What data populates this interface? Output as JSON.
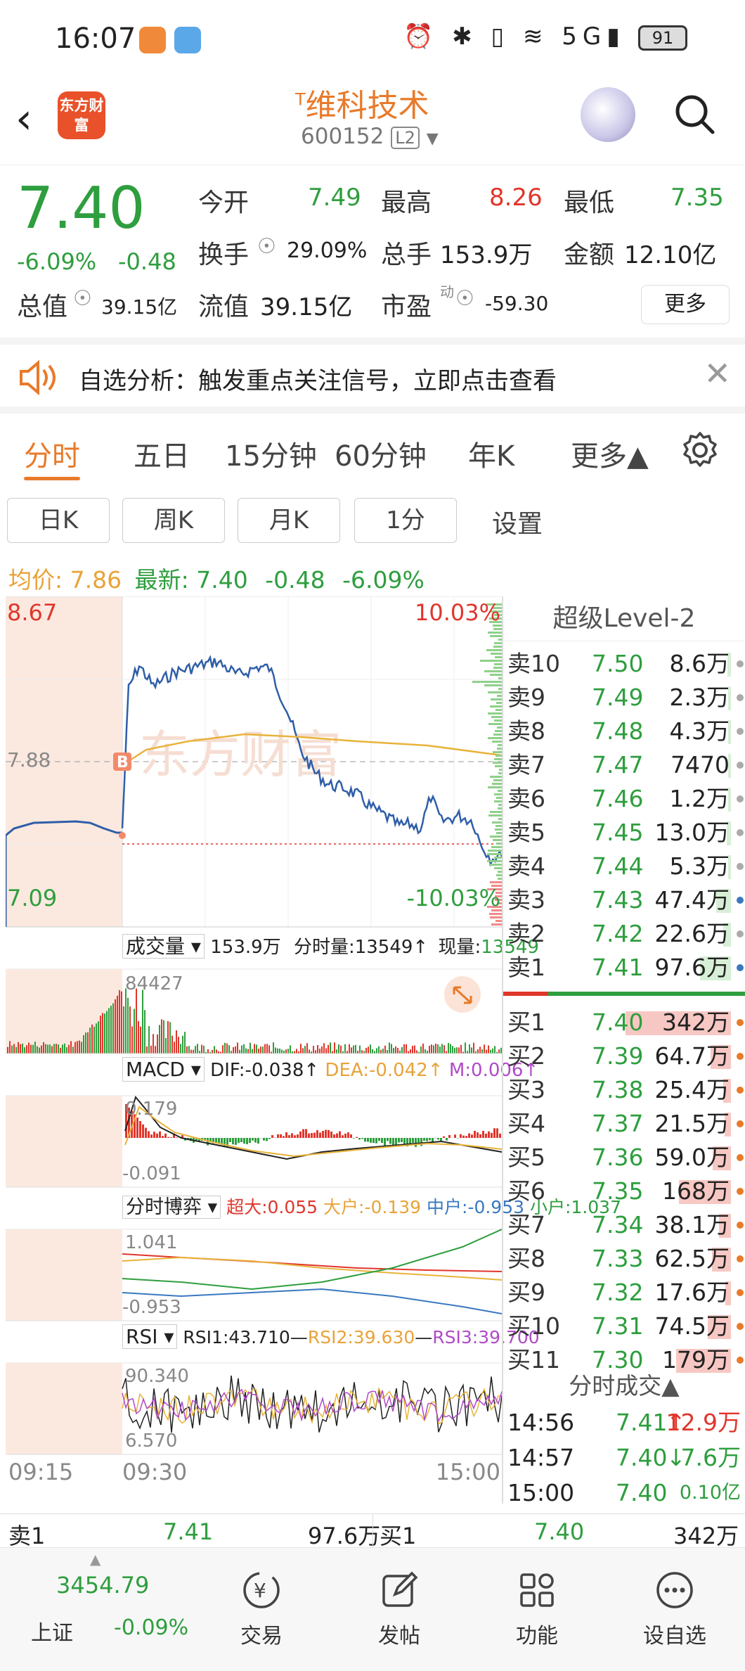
{
  "status_bar": {
    "time": "16:07",
    "battery": "91",
    "icons": "⏰ ✱ ▯ ≋ 5G▮"
  },
  "header": {
    "logo_text": "东方财富",
    "stock_prefix": "T",
    "stock_name": "维科技术",
    "stock_code": "600152",
    "level_badge": "L2"
  },
  "quote": {
    "price": "7.40",
    "change_pct": "-6.09%",
    "change_amt": "-0.48",
    "open_label": "今开",
    "open": "7.49",
    "high_label": "最高",
    "high": "8.26",
    "low_label": "最低",
    "low": "7.35",
    "turnover_label": "换手",
    "turnover": "29.09%",
    "volume_label": "总手",
    "volume": "153.9万",
    "amount_label": "金额",
    "amount": "12.10亿",
    "mktcap_label": "总值",
    "mktcap": "39.15亿",
    "float_label": "流值",
    "float": "39.15亿",
    "pe_label": "市盈",
    "pe_sup": "动",
    "pe": "-59.30",
    "more_button": "更多"
  },
  "banner": {
    "text": "自选分析：触发重点关注信号，立即点击查看"
  },
  "tabs": [
    "分时",
    "五日",
    "15分钟",
    "60分钟",
    "年K",
    "更多▲"
  ],
  "sub_buttons": [
    "日K",
    "周K",
    "月K",
    "1分",
    "设置"
  ],
  "info_line": {
    "avg_label": "均价:",
    "avg": "7.86",
    "latest_label": "最新:",
    "latest": "7.40",
    "chg": "-0.48",
    "pct": "-6.09%"
  },
  "intraday": {
    "y_high": "8.67",
    "y_mid": "7.88",
    "y_low": "7.09",
    "pct_high": "10.03%",
    "pct_low": "-10.03%",
    "buy_marker": "B",
    "watermark": "东方财富"
  },
  "volume_panel": {
    "selector": "成交量",
    "total": "153.9万",
    "tick_label": "分时量:13549↑",
    "now_label": "现量:",
    "now": "13549",
    "max": "84427"
  },
  "macd_panel": {
    "selector": "MACD",
    "dif": "DIF:-0.038↑",
    "dea": "DEA:-0.042↑",
    "m": "M:0.006↑",
    "top": "0.179",
    "bottom": "-0.091"
  },
  "game_panel": {
    "selector": "分时博弈",
    "super": "超大:0.055",
    "big": "大户:-0.139",
    "mid": "中户:-0.953",
    "small": "小户:1.037",
    "top": "1.041",
    "bottom": "-0.953"
  },
  "rsi_panel": {
    "selector": "RSI",
    "rsi1": "RSI1:43.710",
    "rsi2": "RSI2:39.630",
    "rsi3": "RSI3:39.700",
    "top": "90.340",
    "bottom": "6.570"
  },
  "time_axis": {
    "t1": "09:15",
    "t2": "09:30",
    "t3": "15:00"
  },
  "order_book": {
    "title": "超级Level-2",
    "asks": [
      {
        "label": "卖10",
        "price": "7.50",
        "vol": "8.6万",
        "bar": 0.03
      },
      {
        "label": "卖9",
        "price": "7.49",
        "vol": "2.3万",
        "bar": 0.01
      },
      {
        "label": "卖8",
        "price": "7.48",
        "vol": "4.3万",
        "bar": 0.02
      },
      {
        "label": "卖7",
        "price": "7.47",
        "vol": "7470",
        "bar": 0.01
      },
      {
        "label": "卖6",
        "price": "7.46",
        "vol": "1.2万",
        "bar": 0.01
      },
      {
        "label": "卖5",
        "price": "7.45",
        "vol": "13.0万",
        "bar": 0.04
      },
      {
        "label": "卖4",
        "price": "7.44",
        "vol": "5.3万",
        "bar": 0.02
      },
      {
        "label": "卖3",
        "price": "7.43",
        "vol": "47.4万",
        "bar": 0.14
      },
      {
        "label": "卖2",
        "price": "7.42",
        "vol": "22.6万",
        "bar": 0.07
      },
      {
        "label": "卖1",
        "price": "7.41",
        "vol": "97.6万",
        "bar": 0.29
      }
    ],
    "bids": [
      {
        "label": "买1",
        "price": "7.40",
        "vol": "342万",
        "bar": 1.0
      },
      {
        "label": "买2",
        "price": "7.39",
        "vol": "64.7万",
        "bar": 0.19
      },
      {
        "label": "买3",
        "price": "7.38",
        "vol": "25.4万",
        "bar": 0.07
      },
      {
        "label": "买4",
        "price": "7.37",
        "vol": "21.5万",
        "bar": 0.06
      },
      {
        "label": "买5",
        "price": "7.36",
        "vol": "59.0万",
        "bar": 0.17
      },
      {
        "label": "买6",
        "price": "7.35",
        "vol": "168万",
        "bar": 0.49
      },
      {
        "label": "买7",
        "price": "7.34",
        "vol": "38.1万",
        "bar": 0.11
      },
      {
        "label": "买8",
        "price": "7.33",
        "vol": "62.5万",
        "bar": 0.18
      },
      {
        "label": "买9",
        "price": "7.32",
        "vol": "17.6万",
        "bar": 0.05
      },
      {
        "label": "买10",
        "price": "7.31",
        "vol": "74.5万",
        "bar": 0.22
      },
      {
        "label": "买11",
        "price": "7.30",
        "vol": "179万",
        "bar": 0.52
      }
    ],
    "trades_title": "分时成交▲",
    "trades": [
      {
        "time": "14:56",
        "price": "7.41",
        "arrow": "↑",
        "vol": "12.9万"
      },
      {
        "time": "14:57",
        "price": "7.40",
        "arrow": "↓",
        "vol": "7.6万"
      },
      {
        "time": "15:00",
        "price": "7.40",
        "arrow": "",
        "vol": "0.10亿"
      }
    ]
  },
  "bottom_quote": {
    "ask_label": "卖1",
    "ask_price": "7.41",
    "ask_vol": "97.6万",
    "bid_label": "买1",
    "bid_price": "7.40",
    "bid_vol": "342万"
  },
  "nav": {
    "index_value": "3454.79",
    "index_name": "上证",
    "index_pct": "-0.09%",
    "items": [
      "交易",
      "发帖",
      "功能",
      "设自选"
    ]
  }
}
